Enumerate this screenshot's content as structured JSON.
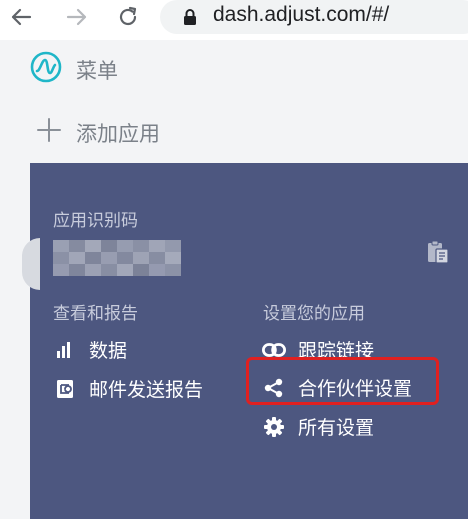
{
  "browser": {
    "url": "dash.adjust.com/#/",
    "back_icon": "arrow-left-icon",
    "forward_icon": "arrow-right-icon",
    "reload_icon": "reload-icon",
    "lock_icon": "lock-icon"
  },
  "sidebar": {
    "menu_label": "菜单",
    "add_app_label": "添加应用"
  },
  "app_panel": {
    "token_label": "应用识别码",
    "view_section": {
      "heading": "查看和报告",
      "items": [
        {
          "label": "数据",
          "icon": "bar-chart-icon"
        },
        {
          "label": "邮件发送报告",
          "icon": "report-icon"
        }
      ]
    },
    "settings_section": {
      "heading": "设置您的应用",
      "items": [
        {
          "label": "跟踪链接",
          "icon": "link-icon"
        },
        {
          "label": "合作伙伴设置",
          "icon": "share-icon"
        },
        {
          "label": "所有设置",
          "icon": "gear-icon"
        }
      ]
    }
  },
  "colors": {
    "panel_bg": "#4d5780",
    "page_bg": "#f3f4f6",
    "highlight": "#e02020",
    "brand_accent": "#1fb6c8"
  }
}
